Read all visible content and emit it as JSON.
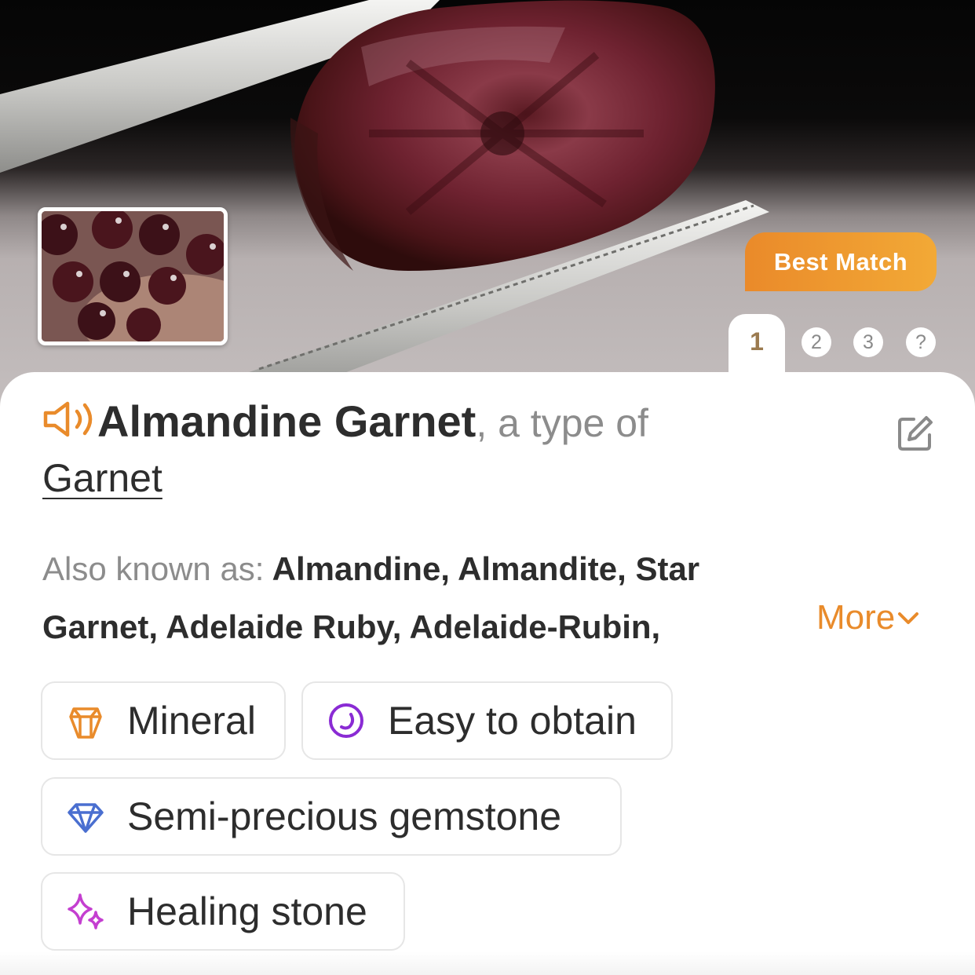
{
  "hero": {
    "badge": "Best Match",
    "pages": [
      "1",
      "2",
      "3",
      "?"
    ],
    "active_page": "1"
  },
  "result": {
    "name": "Almandine Garnet",
    "type_of": ", a type of",
    "parent": "Garnet"
  },
  "aka": {
    "label": "Also known as:",
    "names": "Almandine, Almandite, Star Garnet, Adelaide Ruby, Adelaide-Rubin,",
    "more": "More"
  },
  "tags": [
    {
      "label": "Mineral",
      "icon": "crystal-icon",
      "color": "#e98b2b"
    },
    {
      "label": "Easy to obtain",
      "icon": "availability-ring-icon",
      "color": "#8a2bd4"
    },
    {
      "label": "Semi-precious gemstone",
      "icon": "diamond-icon",
      "color": "#4a6fd0"
    },
    {
      "label": "Healing stone",
      "icon": "sparkles-icon",
      "color": "#c43fd0"
    }
  ],
  "colors": {
    "accent": "#e98b2b",
    "title": "#2d2d2d",
    "muted": "#8c8c8c"
  }
}
